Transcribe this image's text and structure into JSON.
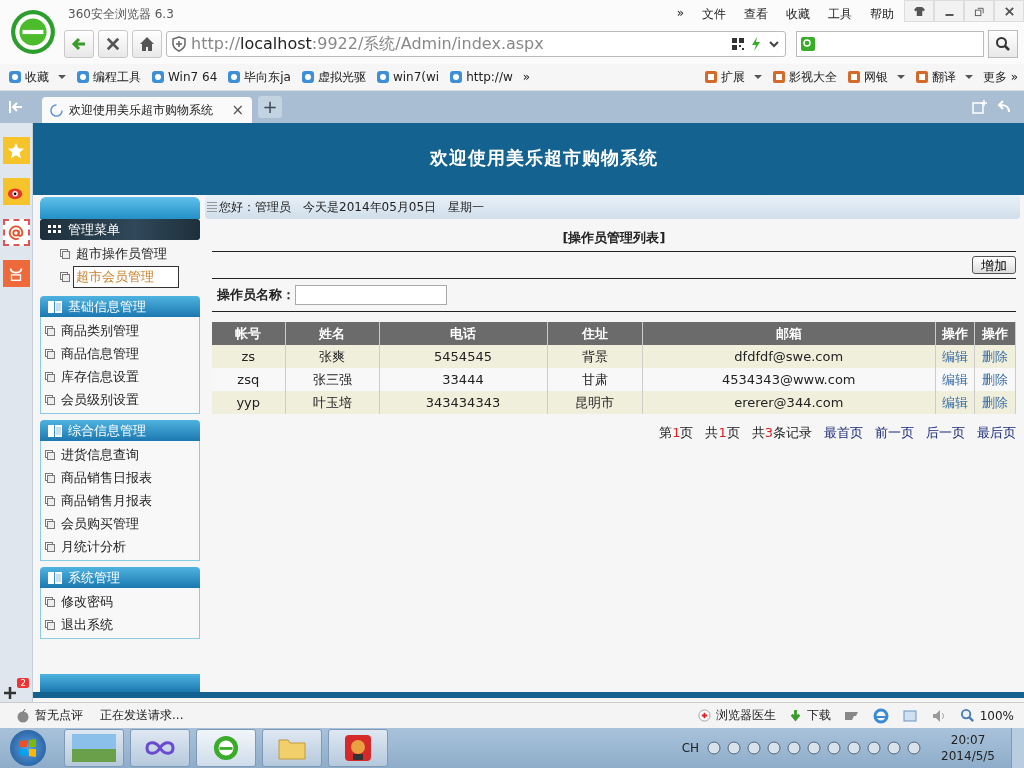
{
  "browser": {
    "title": "360安全浏览器 6.3",
    "menu": [
      "»",
      "文件",
      "查看",
      "收藏",
      "工具",
      "帮助"
    ],
    "url": {
      "scheme": "http://",
      "host": "localhost",
      "rest": ":9922/系统/Admin/index.aspx"
    },
    "bookmarks": [
      {
        "label": "收藏",
        "dropdown": true
      },
      {
        "label": "编程工具",
        "dropdown": false
      },
      {
        "label": "Win7 64",
        "dropdown": false
      },
      {
        "label": "毕向东ja",
        "dropdown": false
      },
      {
        "label": "虚拟光驱",
        "dropdown": false
      },
      {
        "label": "win7(wi",
        "dropdown": false
      },
      {
        "label": "http://w",
        "dropdown": false
      }
    ],
    "bookmarks_more": "»",
    "tools": [
      {
        "label": "扩展",
        "dropdown": true
      },
      {
        "label": "影视大全",
        "dropdown": false
      },
      {
        "label": "网银",
        "dropdown": true
      },
      {
        "label": "翻译",
        "dropdown": true
      }
    ],
    "tools_more": "更多 »",
    "tabs": [
      {
        "title": "欢迎使用美乐超市购物系统",
        "close": "×",
        "selected": true
      }
    ],
    "new_tab": "+",
    "rail_badge": "2"
  },
  "page": {
    "header_title": "欢迎使用美乐超市购物系统",
    "greeting": "您好：管理员",
    "date": "今天是2014年05月05日",
    "weekday": "星期一",
    "menu": [
      {
        "title": "管理菜单",
        "kind": "main",
        "items": [
          {
            "label": "超市操作员管理",
            "selected": false
          },
          {
            "label": "超市会员管理",
            "selected": true
          }
        ]
      },
      {
        "title": "基础信息管理",
        "kind": "group",
        "items": [
          {
            "label": "商品类别管理",
            "selected": false
          },
          {
            "label": "商品信息管理",
            "selected": false
          },
          {
            "label": "库存信息设置",
            "selected": false
          },
          {
            "label": "会员级别设置",
            "selected": false
          }
        ]
      },
      {
        "title": "综合信息管理",
        "kind": "group",
        "items": [
          {
            "label": "进货信息查询",
            "selected": false
          },
          {
            "label": "商品销售日报表",
            "selected": false
          },
          {
            "label": "商品销售月报表",
            "selected": false
          },
          {
            "label": "会员购买管理",
            "selected": false
          },
          {
            "label": "月统计分析",
            "selected": false
          }
        ]
      },
      {
        "title": "系统管理",
        "kind": "group",
        "items": [
          {
            "label": "修改密码",
            "selected": false
          },
          {
            "label": "退出系统",
            "selected": false
          }
        ]
      }
    ],
    "list_title": "[操作员管理列表]",
    "add_button": "增加",
    "search_label": "操作员名称：",
    "table": {
      "columns": [
        "帐号",
        "姓名",
        "电话",
        "住址",
        "邮箱",
        "操作",
        "操作"
      ],
      "rows": [
        {
          "cells": [
            "zs",
            "张爽",
            "5454545",
            "背景",
            "dfdfdf@swe.com"
          ],
          "edit": "编辑",
          "delete": "删除"
        },
        {
          "cells": [
            "zsq",
            "张三强",
            "33444",
            "甘肃",
            "4534343@www.com"
          ],
          "edit": "编辑",
          "delete": "删除"
        },
        {
          "cells": [
            "yyp",
            "叶玉培",
            "343434343",
            "昆明市",
            "ererer@344.com"
          ],
          "edit": "编辑",
          "delete": "删除"
        }
      ]
    },
    "pager": {
      "counts": [
        {
          "prefix": "第",
          "number": "1",
          "suffix": "页"
        },
        {
          "prefix": "共",
          "number": "1",
          "suffix": "页"
        },
        {
          "prefix": "共",
          "number": "3",
          "suffix": "条记录"
        }
      ],
      "links": [
        "最首页",
        "前一页",
        "后一页",
        "最后页"
      ]
    }
  },
  "status_bar": {
    "rating": "暂无点评",
    "loading": "正在发送请求...",
    "doctor": "浏览器医生",
    "download": "下载",
    "zoom": "100%"
  },
  "taskbar": {
    "lang": "CH",
    "time": "20:07",
    "date": "2014/5/5"
  }
}
